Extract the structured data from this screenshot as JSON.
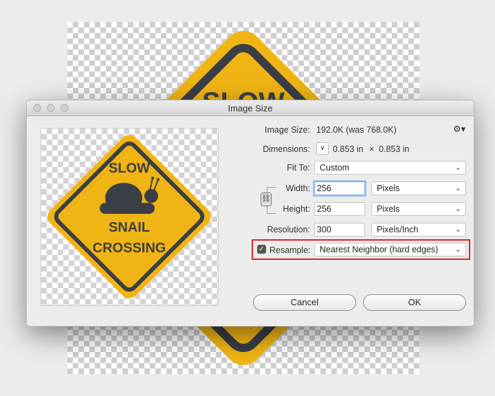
{
  "window": {
    "title": "Image Size"
  },
  "preview_sign": {
    "line1": "SLOW",
    "line2": "SNAIL",
    "line3": "CROSSING"
  },
  "background_sign": {
    "visible_text": "SLOW"
  },
  "fields": {
    "image_size_label": "Image Size:",
    "image_size_value": "192.0K (was 768.0K)",
    "dimensions_label": "Dimensions:",
    "dimensions_width": "0.853 in",
    "dimensions_times": "×",
    "dimensions_height": "0.853 in",
    "fit_to_label": "Fit To:",
    "fit_to_value": "Custom",
    "width_label": "Width:",
    "width_value": "256",
    "width_unit": "Pixels",
    "height_label": "Height:",
    "height_value": "256",
    "height_unit": "Pixels",
    "resolution_label": "Resolution:",
    "resolution_value": "300",
    "resolution_unit": "Pixels/Inch",
    "resample_label": "Resample:",
    "resample_checked": true,
    "resample_value": "Nearest Neighbor (hard edges)"
  },
  "buttons": {
    "cancel": "Cancel",
    "ok": "OK"
  },
  "icons": {
    "gear": "gear-icon",
    "chain": "chain-link-icon",
    "chevron": "chevron-down-icon"
  },
  "colors": {
    "sign_yellow": "#F0B414",
    "sign_dark": "#3a3f46",
    "highlight": "#d6262e"
  }
}
